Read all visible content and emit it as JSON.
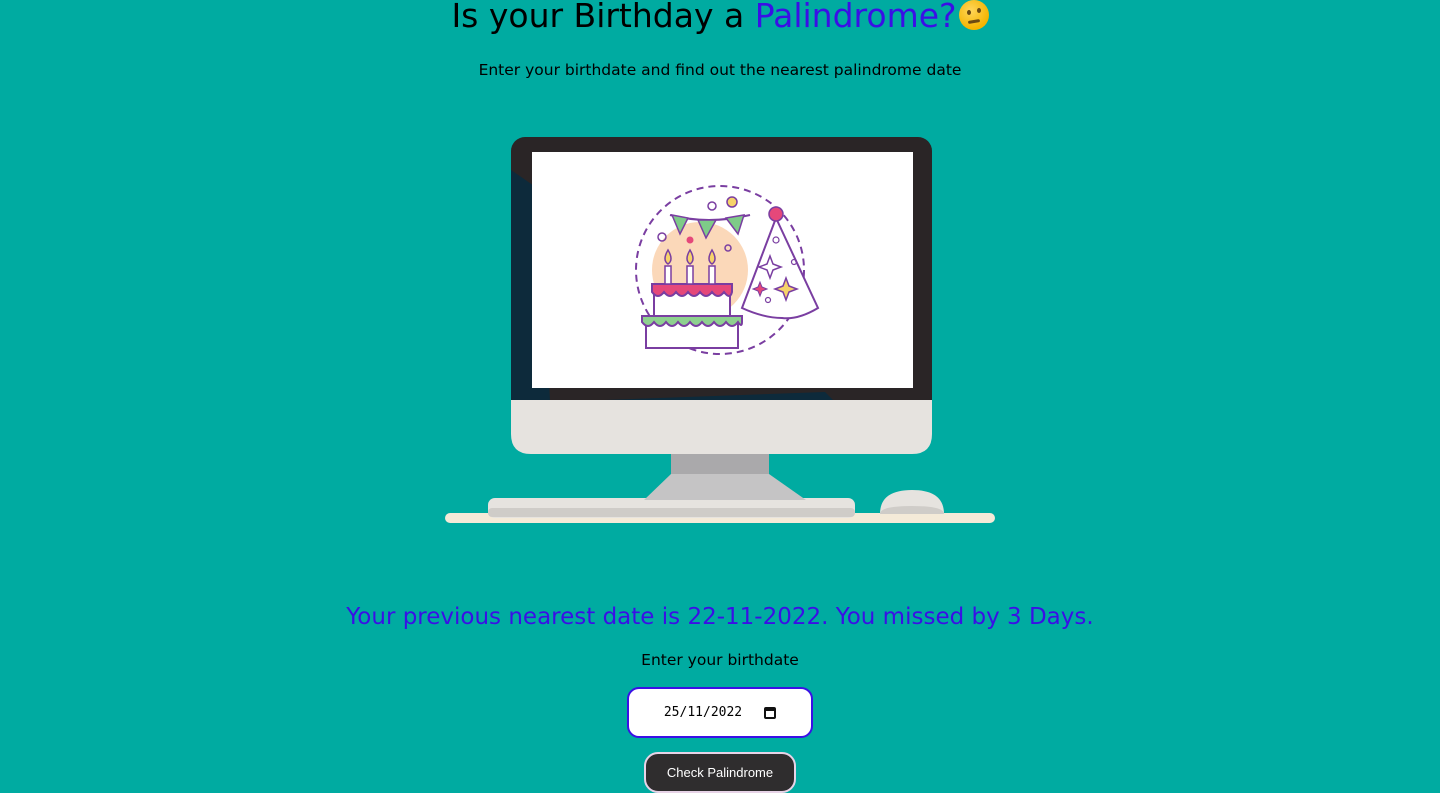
{
  "header": {
    "title_prefix": "Is your Birthday a ",
    "title_accent": "Palindrome?",
    "subtitle": "Enter your birthdate and find out the nearest palindrome date"
  },
  "illustration": {
    "name": "computer-with-birthday-cake-and-party-hat"
  },
  "result": {
    "message": "Your previous nearest date is 22-11-2022. You missed by 3 Days."
  },
  "form": {
    "label": "Enter your birthdate",
    "date_value": "25/11/2022",
    "button_label": "Check Palindrome"
  },
  "colors": {
    "background": "#00aba1",
    "accent": "#3a0fe6",
    "button": "#2f2d2e"
  }
}
